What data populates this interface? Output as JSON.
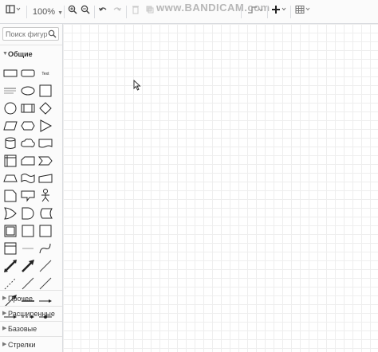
{
  "toolbar": {
    "zoom_label": "100%",
    "watermark": "www.BANDICAM.com"
  },
  "sidebar": {
    "search_placeholder": "Поиск фигур",
    "sections": [
      {
        "label": "Общие",
        "open": true
      },
      {
        "label": "Прочее",
        "open": false
      },
      {
        "label": "Расширенные",
        "open": false
      },
      {
        "label": "Базовые",
        "open": false
      },
      {
        "label": "Стрелки",
        "open": false
      }
    ]
  },
  "shapes": {
    "count": 36,
    "text_shape_label": "Text"
  },
  "icons": {
    "view": "sidebar-toggle-icon",
    "zoom_in": "zoom-in-icon",
    "zoom_out": "zoom-out-icon",
    "undo": "undo-icon",
    "redo": "redo-icon",
    "insert": "plus-icon",
    "table": "table-icon",
    "search": "search-icon",
    "connector": "waypoint-icon"
  }
}
